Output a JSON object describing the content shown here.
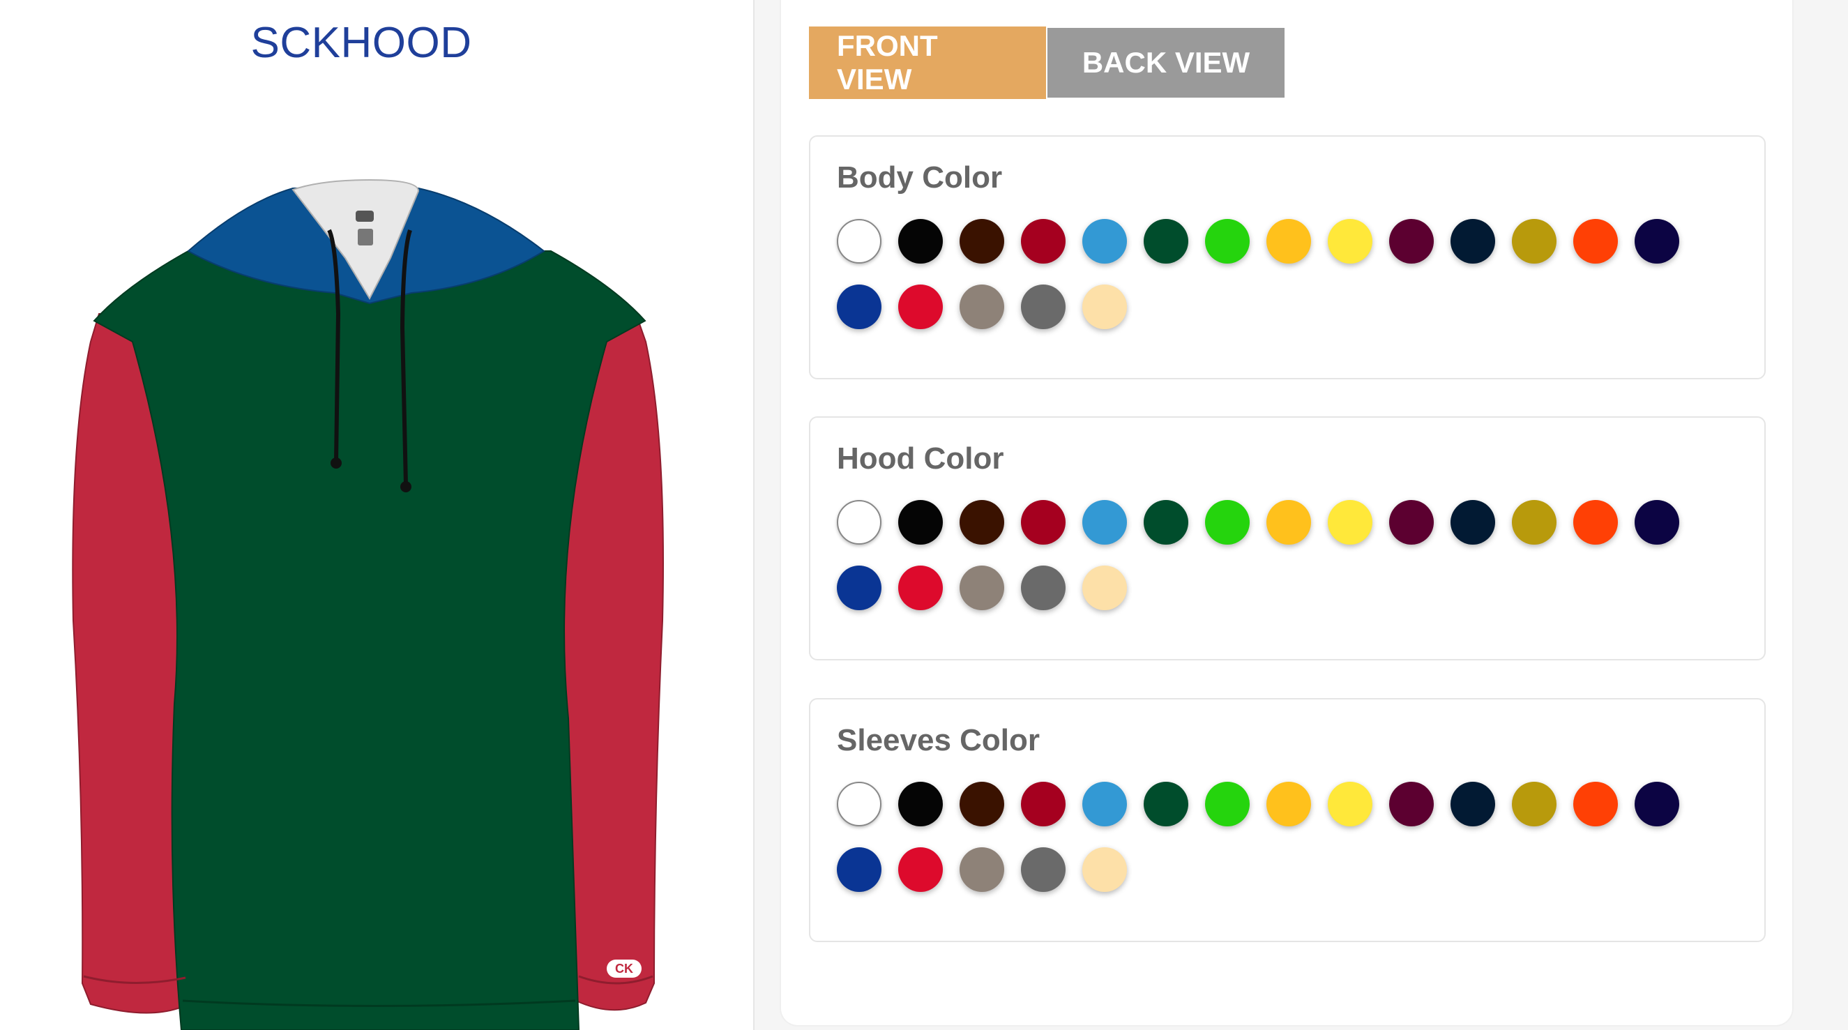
{
  "product": {
    "title": "SCKHOOD",
    "logo_text": "CK"
  },
  "tabs": {
    "front_label": "FRONT VIEW",
    "back_label": "BACK VIEW",
    "active": "front"
  },
  "selected_colors": {
    "body": "#004d2c",
    "hood": "#0b5393",
    "sleeves": "#c0283f"
  },
  "panels": [
    {
      "key": "body",
      "title": "Body Color"
    },
    {
      "key": "hood",
      "title": "Hood Color"
    },
    {
      "key": "sleeves",
      "title": "Sleeves Color"
    }
  ],
  "palette": [
    {
      "name": "white",
      "hex": "#ffffff"
    },
    {
      "name": "black",
      "hex": "#050505"
    },
    {
      "name": "brown",
      "hex": "#3a1200"
    },
    {
      "name": "cardinal",
      "hex": "#a5001f"
    },
    {
      "name": "columbia-blue",
      "hex": "#3399d4"
    },
    {
      "name": "dark-green",
      "hex": "#004d2c"
    },
    {
      "name": "lime",
      "hex": "#25d40d"
    },
    {
      "name": "gold",
      "hex": "#ffc11c"
    },
    {
      "name": "yellow",
      "hex": "#ffe83a"
    },
    {
      "name": "maroon",
      "hex": "#5c0030"
    },
    {
      "name": "navy",
      "hex": "#021a33"
    },
    {
      "name": "vegas-gold",
      "hex": "#b89a0c"
    },
    {
      "name": "orange",
      "hex": "#ff4005"
    },
    {
      "name": "midnight",
      "hex": "#0c0443"
    },
    {
      "name": "royal",
      "hex": "#0a3594"
    },
    {
      "name": "red",
      "hex": "#dd0a2c"
    },
    {
      "name": "khaki",
      "hex": "#8e8278"
    },
    {
      "name": "graphite",
      "hex": "#6a6a6a"
    },
    {
      "name": "cream",
      "hex": "#fde0a8"
    }
  ]
}
